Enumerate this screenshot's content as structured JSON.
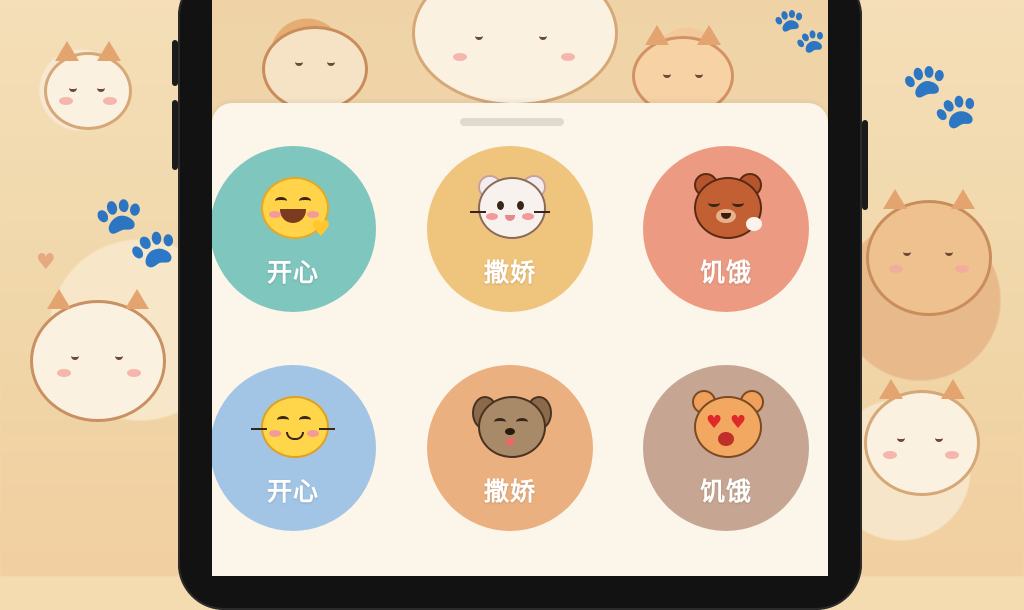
{
  "colors": {
    "tile_teal": "#7fc6bf",
    "tile_gold": "#efc47c",
    "tile_coral": "#ec9b82",
    "tile_blue": "#a3c5e5",
    "tile_orange": "#ebb07f",
    "tile_taupe": "#c6a692",
    "sheet": "#fbf5ea"
  },
  "emotions": [
    {
      "label": "开心",
      "icon": "grinning-face-heart-icon",
      "color": "#7fc6bf"
    },
    {
      "label": "撒娇",
      "icon": "white-cat-face-icon",
      "color": "#efc47c"
    },
    {
      "label": "饥饿",
      "icon": "bear-face-icon",
      "color": "#ec9b82"
    },
    {
      "label": "开心",
      "icon": "smiling-cat-whisker-face-icon",
      "color": "#a3c5e5"
    },
    {
      "label": "撒娇",
      "icon": "brown-puppy-face-icon",
      "color": "#ebb07f"
    },
    {
      "label": "饥饿",
      "icon": "heart-eyes-cat-face-icon",
      "color": "#c6a692"
    }
  ]
}
